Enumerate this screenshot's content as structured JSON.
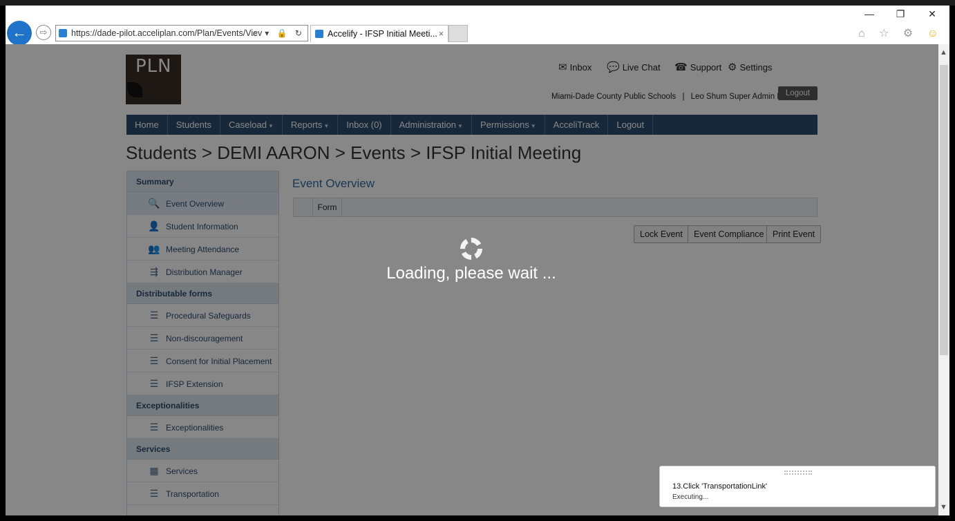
{
  "browser": {
    "url": "https://dade-pilot.acceliplan.com/Plan/Events/Viev",
    "tab_title": "Accelify - IFSP Initial Meeti...",
    "tab_close": "×",
    "addr_icons": "⌕ ▾ 🔒 ↻",
    "window_controls": [
      "—",
      "❐",
      "✕"
    ],
    "toolbar_icons": [
      "⌂",
      "☆",
      "⚙",
      "☺"
    ]
  },
  "logo": {
    "text": "PLN"
  },
  "top_links": {
    "inbox": "Inbox",
    "live_chat": "Live Chat",
    "support": "Support",
    "settings": "Settings"
  },
  "account": {
    "org": "Miami-Dade County Public Schools",
    "separator": "|",
    "user": "Leo Shum Super Admin Plus",
    "logout": "Logout"
  },
  "nav": {
    "items": [
      {
        "label": "Home",
        "dropdown": false
      },
      {
        "label": "Students",
        "dropdown": false
      },
      {
        "label": "Caseload",
        "dropdown": true
      },
      {
        "label": "Reports",
        "dropdown": true
      },
      {
        "label": "Inbox (0)",
        "dropdown": false
      },
      {
        "label": "Administration",
        "dropdown": true
      },
      {
        "label": "Permissions",
        "dropdown": true
      },
      {
        "label": "AcceliTrack",
        "dropdown": false
      },
      {
        "label": "Logout",
        "dropdown": false
      }
    ]
  },
  "breadcrumb": "Students > DEMI AARON > Events > IFSP Initial Meeting",
  "sidebar": {
    "summary_title": "Summary",
    "summary_items": [
      "Event Overview",
      "Student Information",
      "Meeting Attendance",
      "Distribution Manager"
    ],
    "forms_title": "Distributable forms",
    "forms_items": [
      "Procedural Safeguards",
      "Non-discouragement",
      "Consent for Initial Placement",
      "IFSP Extension"
    ],
    "except_title": "Exceptionalities",
    "except_items": [
      "Exceptionalities"
    ],
    "services_title": "Services",
    "services_items": [
      "Services",
      "Transportation"
    ]
  },
  "main": {
    "section_title": "Event Overview",
    "table_header": "Form",
    "buttons": {
      "lock": "Lock Event",
      "compliance": "Event Compliance",
      "print": "Print Event"
    }
  },
  "loading": {
    "text": "Loading, please wait ..."
  },
  "toast": {
    "step": "13.Click 'TransportationLink'",
    "status": "Executing..."
  }
}
